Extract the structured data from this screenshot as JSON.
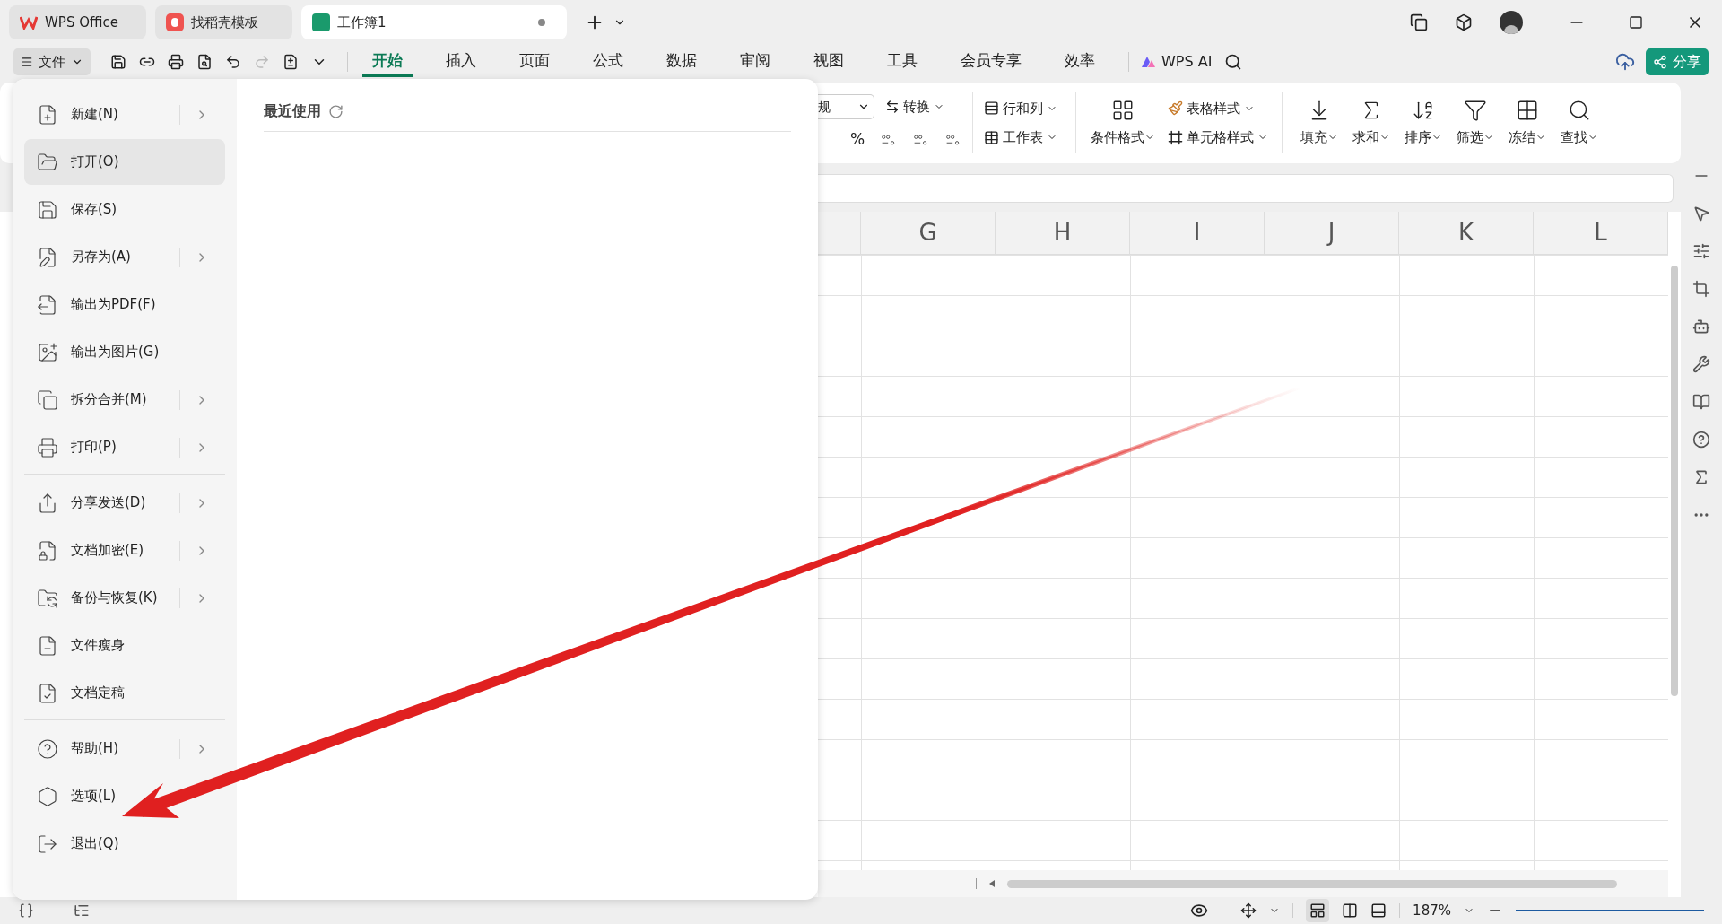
{
  "window_tabs": [
    {
      "kind": "wps",
      "label": "WPS Office",
      "selected": false
    },
    {
      "kind": "docer",
      "label": "找稻壳模板",
      "selected": false
    },
    {
      "kind": "sheet",
      "label": "工作簿1",
      "selected": true,
      "modified": true
    }
  ],
  "file_button": {
    "label": "文件"
  },
  "menu_tabs": [
    {
      "label": "开始",
      "selected": true
    },
    {
      "label": "插入",
      "selected": false
    },
    {
      "label": "页面",
      "selected": false
    },
    {
      "label": "公式",
      "selected": false
    },
    {
      "label": "数据",
      "selected": false
    },
    {
      "label": "审阅",
      "selected": false
    },
    {
      "label": "视图",
      "selected": false
    },
    {
      "label": "工具",
      "selected": false
    },
    {
      "label": "会员专享",
      "selected": false
    },
    {
      "label": "效率",
      "selected": false
    }
  ],
  "ai_button": {
    "label": "WPS AI"
  },
  "share_button": {
    "label": "分享"
  },
  "ribbon": {
    "format_dropdown": "规",
    "convert": "转换",
    "percent": "%",
    "rows_cols": "行和列",
    "worksheet": "工作表",
    "conditional_format": "条件格式",
    "table_style": "表格样式",
    "cell_style": "单元格样式",
    "big_buttons": [
      "填充",
      "求和",
      "排序",
      "筛选",
      "冻结",
      "查找"
    ]
  },
  "columns": [
    "G",
    "H",
    "I",
    "J",
    "K",
    "L"
  ],
  "file_menu": {
    "sections": [
      [
        {
          "label": "新建(N)",
          "submenu": true,
          "selected": false
        },
        {
          "label": "打开(O)",
          "submenu": false,
          "selected": true
        },
        {
          "label": "保存(S)",
          "submenu": false,
          "selected": false
        },
        {
          "label": "另存为(A)",
          "submenu": true,
          "selected": false
        },
        {
          "label": "输出为PDF(F)",
          "submenu": false,
          "selected": false
        },
        {
          "label": "输出为图片(G)",
          "submenu": false,
          "selected": false
        },
        {
          "label": "拆分合并(M)",
          "submenu": true,
          "selected": false
        },
        {
          "label": "打印(P)",
          "submenu": true,
          "selected": false
        }
      ],
      [
        {
          "label": "分享发送(D)",
          "submenu": true,
          "selected": false
        },
        {
          "label": "文档加密(E)",
          "submenu": true,
          "selected": false
        },
        {
          "label": "备份与恢复(K)",
          "submenu": true,
          "selected": false
        },
        {
          "label": "文件瘦身",
          "submenu": false,
          "selected": false
        },
        {
          "label": "文档定稿",
          "submenu": false,
          "selected": false
        }
      ],
      [
        {
          "label": "帮助(H)",
          "submenu": true,
          "selected": false
        },
        {
          "label": "选项(L)",
          "submenu": false,
          "selected": false
        },
        {
          "label": "退出(Q)",
          "submenu": false,
          "selected": false
        }
      ]
    ],
    "recent_title": "最近使用"
  },
  "status_bar": {
    "zoom": "187%"
  }
}
